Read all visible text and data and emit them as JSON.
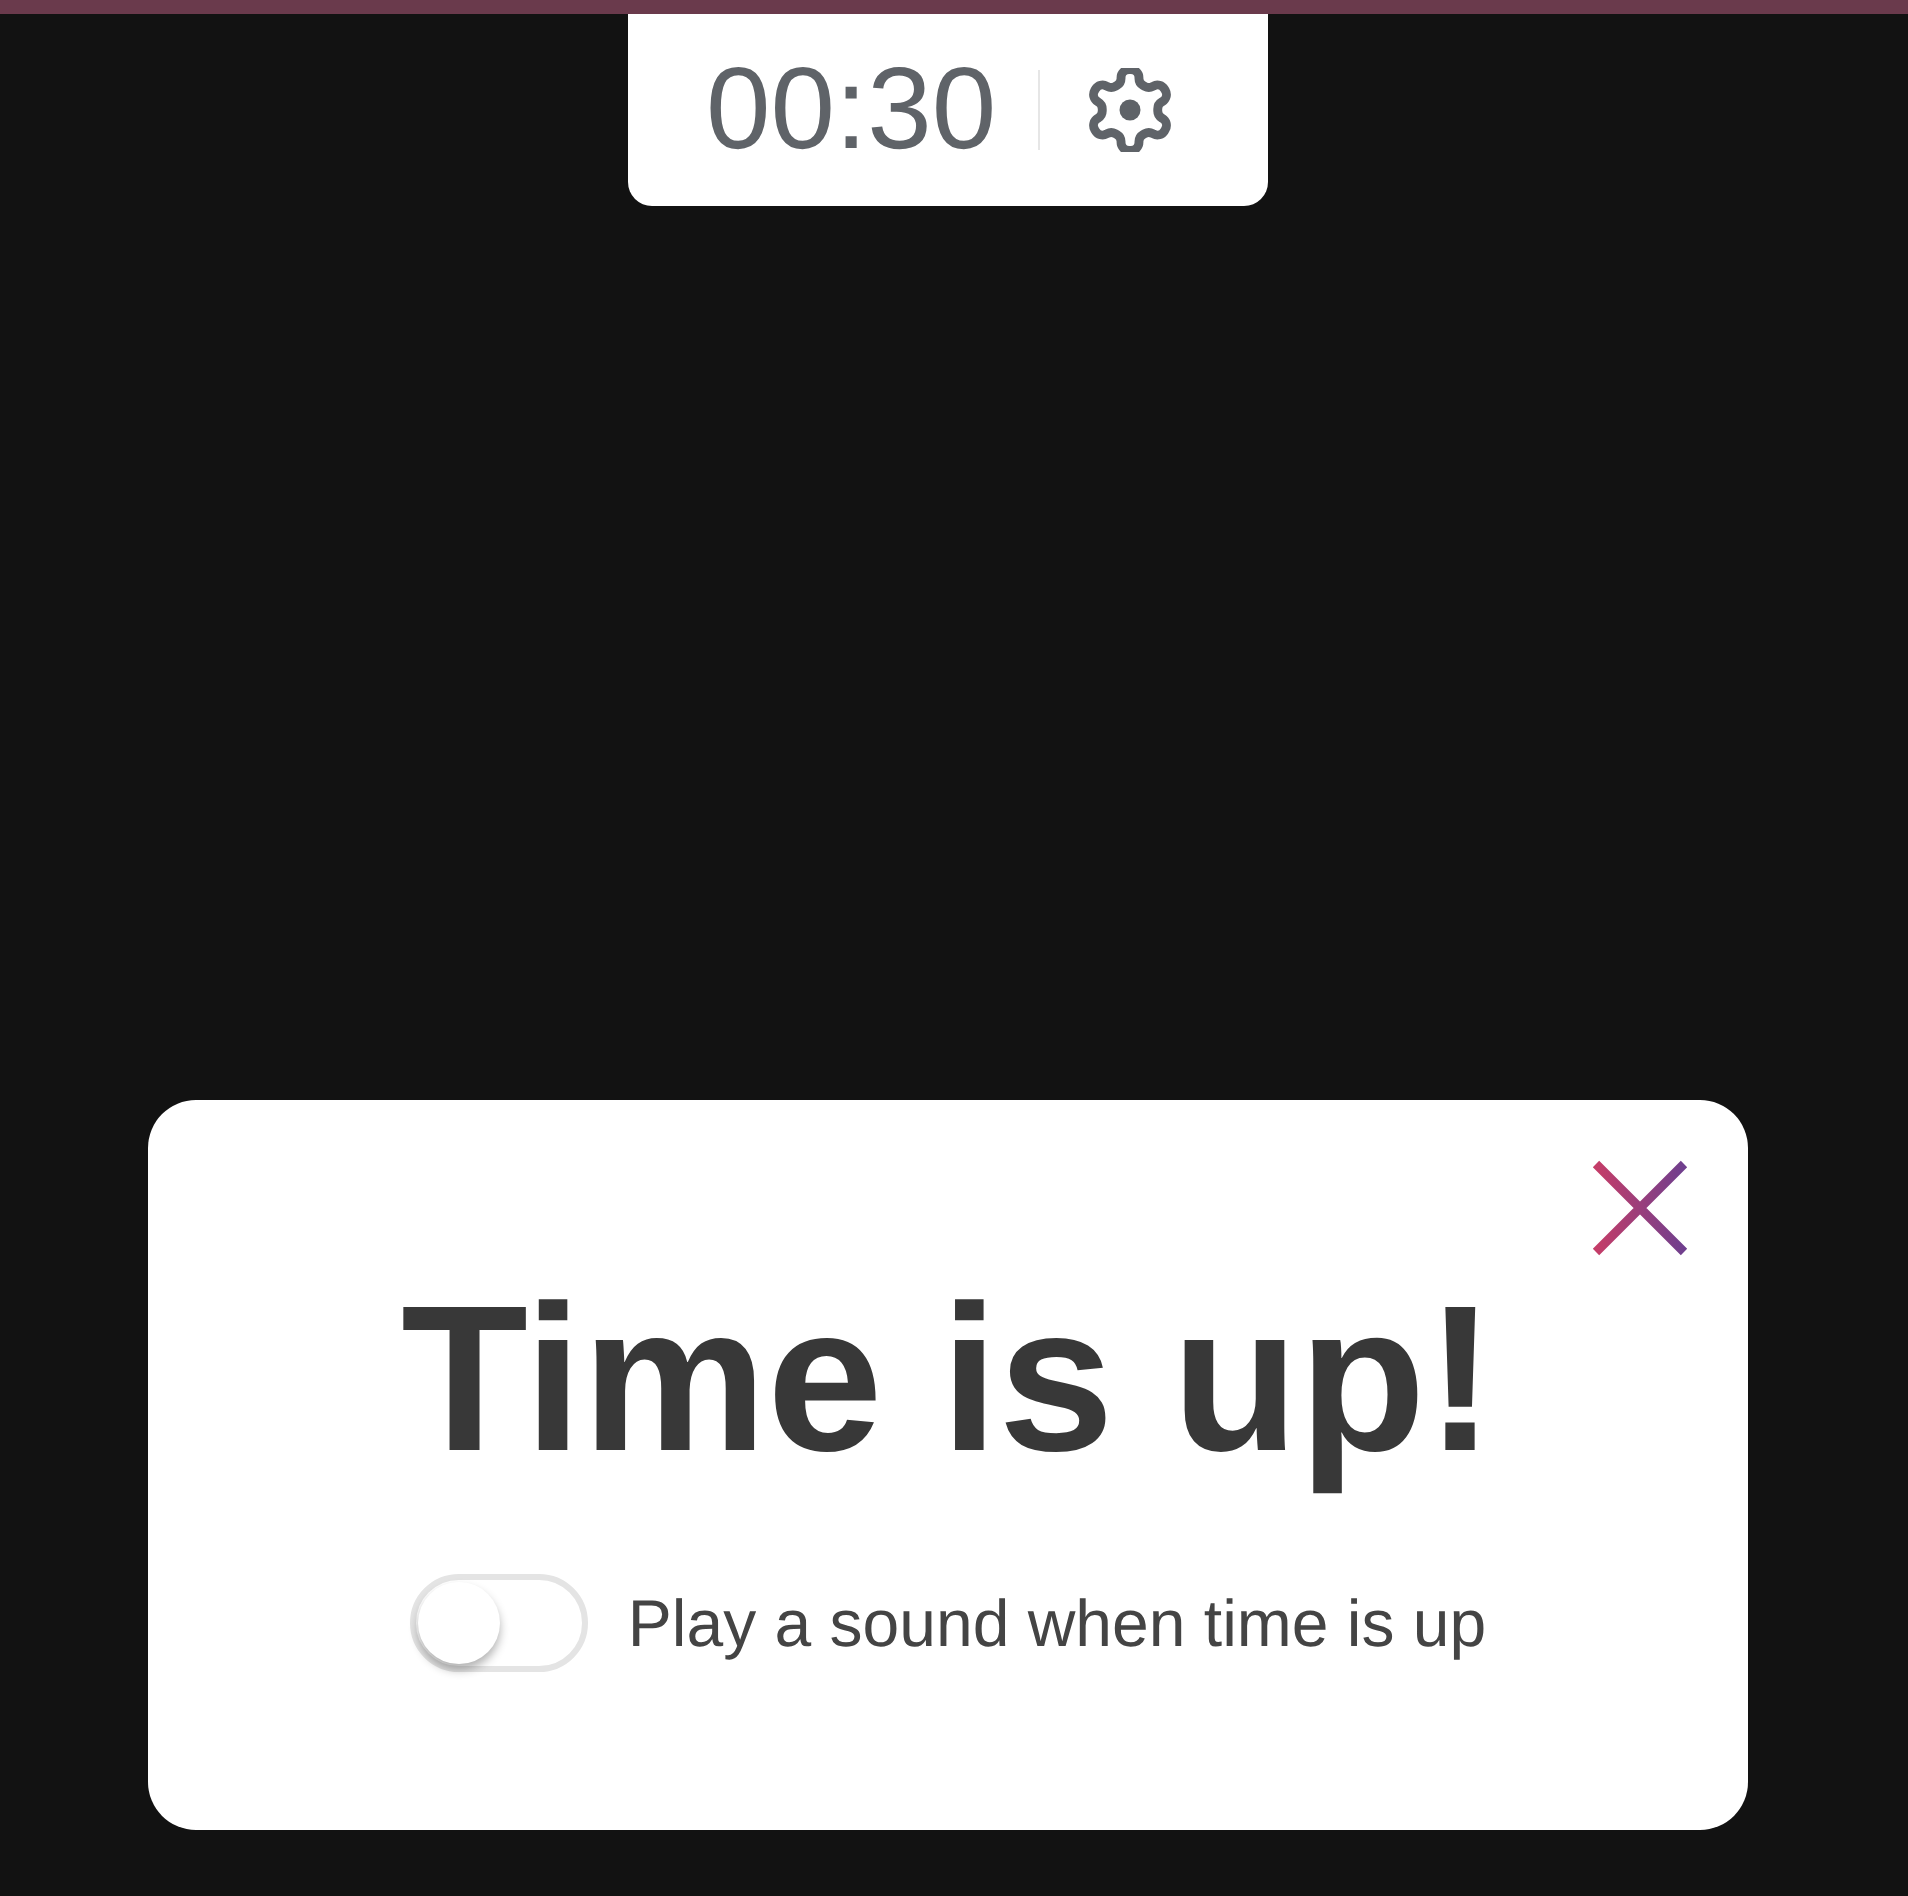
{
  "timer": {
    "time": "00:30"
  },
  "dialog": {
    "title": "Time is up!",
    "sound_toggle": {
      "label": "Play a sound when time is up",
      "on": false
    }
  }
}
